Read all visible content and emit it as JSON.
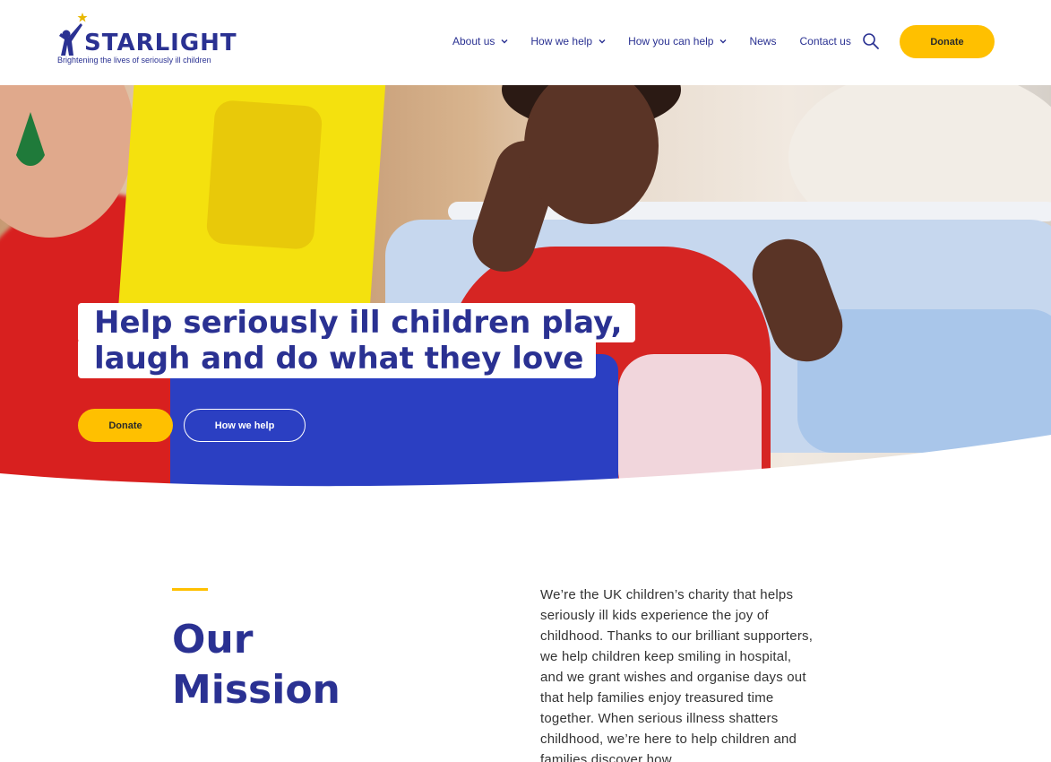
{
  "brand": {
    "name": "STARLIGHT",
    "tagline": "Brightening the lives of seriously ill children",
    "primary_color": "#2a3192",
    "accent_color": "#ffc000"
  },
  "nav": {
    "items": [
      {
        "label": "About us",
        "has_dropdown": true
      },
      {
        "label": "How we help",
        "has_dropdown": true
      },
      {
        "label": "How you can help",
        "has_dropdown": true
      },
      {
        "label": "News",
        "has_dropdown": false
      },
      {
        "label": "Contact us",
        "has_dropdown": false
      }
    ],
    "search_icon": "search-icon",
    "donate_label": "Donate"
  },
  "hero": {
    "headline_line1": "Help seriously ill children play,",
    "headline_line2": "laugh and do what they love",
    "donate_label": "Donate",
    "how_we_help_label": "How we help"
  },
  "mission": {
    "title_line1": "Our",
    "title_line2": "Mission",
    "body": "We’re the UK children’s charity that helps seriously ill kids experience the joy of childhood. Thanks to our brilliant supporters, we help children keep smiling in hospital, and we grant wishes and organise days out that help families enjoy treasured time together. When serious illness shatters childhood, we’re here to help children and families discover how"
  }
}
